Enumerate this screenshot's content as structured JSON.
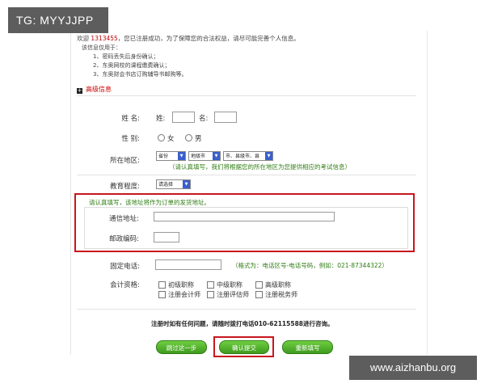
{
  "watermarks": {
    "top_left": "TG: MYYJJPP",
    "bottom_right": "www.aizhanbu.org"
  },
  "notice": {
    "welcome_prefix": "欢迎",
    "user_number": "1313455",
    "welcome_suffix": "，您已注册成功，为了保障您的合法权益，请尽可能完善个人信息。",
    "intro": "该信息仅用于：",
    "items": [
      "1、密码丢失后身份确认；",
      "2、东奥网校的课程缴费确认；",
      "3、东奥财会书店订购辅导书邮购等。"
    ]
  },
  "section": {
    "icon": "plus-square-icon",
    "title": "高级信息"
  },
  "form": {
    "name": {
      "label": "姓 名:",
      "surname": "姓:",
      "given": "名:"
    },
    "gender": {
      "label": "性 别:",
      "options": [
        "女",
        "男"
      ]
    },
    "region": {
      "label": "所在地区:",
      "selects": [
        "省份",
        "地级市",
        "市、县级市、县"
      ],
      "hint": "（请认真填写，我们将根据您的所在地区为您提供相应的考试信息）"
    },
    "education": {
      "label": "教育程度:",
      "select": "请选择"
    },
    "address_group": {
      "hint": "请认真填写，该地址将作为订单的发货地址。",
      "address_label": "通信地址:",
      "zip_label": "邮政编码:"
    },
    "phone": {
      "label": "固定电话:",
      "hint": "（格式为：电话区号-电话号码，例如：021-87344322）"
    },
    "qualification": {
      "label": "会计资格:",
      "options": [
        "初级职称",
        "中级职称",
        "高级职称",
        "注册会计师",
        "注册评估师",
        "注册税务师"
      ]
    }
  },
  "footer": {
    "contact": "注册时如有任何问题，请随时拨打电话010-62115588进行咨询。",
    "buttons": {
      "skip": "跳过这一步",
      "submit": "确认提交",
      "reset": "重新填写"
    }
  },
  "colors": {
    "highlight_border": "#c8161d",
    "hint_green": "#2e7d12",
    "button_green": "#4caf2a",
    "user_number_red": "#c00000"
  }
}
